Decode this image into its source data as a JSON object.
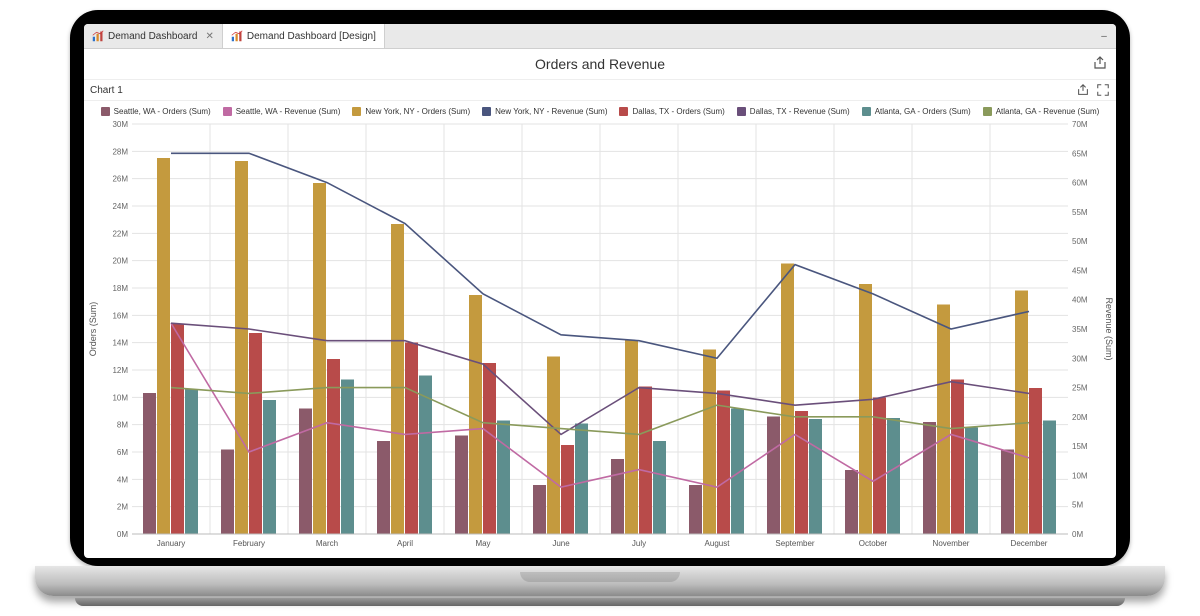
{
  "tabs": [
    {
      "label": "Demand Dashboard"
    },
    {
      "label": "Demand Dashboard [Design]"
    }
  ],
  "header": {
    "title": "Orders and Revenue"
  },
  "chart": {
    "title": "Chart 1"
  },
  "legend": [
    {
      "label": "Seattle, WA - Orders (Sum)",
      "color": "#8b5a6a",
      "kind": "bar"
    },
    {
      "label": "Seattle, WA - Revenue (Sum)",
      "color": "#c06aa3",
      "kind": "line"
    },
    {
      "label": "New York, NY - Orders (Sum)",
      "color": "#c49a3e",
      "kind": "bar"
    },
    {
      "label": "New York, NY - Revenue (Sum)",
      "color": "#4a567e",
      "kind": "line"
    },
    {
      "label": "Dallas, TX - Orders (Sum)",
      "color": "#b84b4a",
      "kind": "bar"
    },
    {
      "label": "Dallas, TX - Revenue (Sum)",
      "color": "#6a4f7a",
      "kind": "line"
    },
    {
      "label": "Atlanta, GA - Orders (Sum)",
      "color": "#5d8e8e",
      "kind": "bar"
    },
    {
      "label": "Atlanta, GA - Revenue (Sum)",
      "color": "#8a9a5b",
      "kind": "line"
    }
  ],
  "chart_data": {
    "type": "bar",
    "title": "Orders and Revenue",
    "xlabel": "",
    "ylabel_left": "Orders (Sum)",
    "ylabel_right": "Revenue (Sum)",
    "categories": [
      "January",
      "February",
      "March",
      "April",
      "May",
      "June",
      "July",
      "August",
      "September",
      "October",
      "November",
      "December"
    ],
    "ylim_left": [
      0,
      30000000
    ],
    "ylim_right": [
      0,
      70000000
    ],
    "ytick_step_left": 2000000,
    "ytick_step_right": 5000000,
    "bar_series": [
      {
        "name": "Seattle, WA - Orders (Sum)",
        "color": "#8b5a6a",
        "values": [
          10300000,
          6200000,
          9200000,
          6800000,
          7200000,
          3600000,
          5500000,
          3600000,
          8600000,
          4700000,
          8200000,
          6200000
        ]
      },
      {
        "name": "New York, NY - Orders (Sum)",
        "color": "#c49a3e",
        "values": [
          27500000,
          27300000,
          25700000,
          22700000,
          17500000,
          13000000,
          14200000,
          13500000,
          19800000,
          18300000,
          16800000,
          17800000
        ]
      },
      {
        "name": "Dallas, TX - Orders (Sum)",
        "color": "#b84b4a",
        "values": [
          15400000,
          14700000,
          12800000,
          14000000,
          12500000,
          6500000,
          10800000,
          10500000,
          9000000,
          10000000,
          11300000,
          10700000
        ]
      },
      {
        "name": "Atlanta, GA - Orders (Sum)",
        "color": "#5d8e8e",
        "values": [
          10600000,
          9800000,
          11300000,
          11600000,
          8300000,
          8100000,
          6800000,
          9200000,
          8400000,
          8500000,
          7800000,
          8300000
        ]
      }
    ],
    "line_series": [
      {
        "name": "Seattle, WA - Revenue (Sum)",
        "color": "#c06aa3",
        "values": [
          36000000,
          14000000,
          19000000,
          17000000,
          18000000,
          8000000,
          11000000,
          8000000,
          17000000,
          9000000,
          17000000,
          13000000
        ]
      },
      {
        "name": "New York, NY - Revenue (Sum)",
        "color": "#4a567e",
        "values": [
          65000000,
          65000000,
          60000000,
          53000000,
          41000000,
          34000000,
          33000000,
          30000000,
          46000000,
          41000000,
          35000000,
          38000000
        ]
      },
      {
        "name": "Dallas, TX - Revenue (Sum)",
        "color": "#6a4f7a",
        "values": [
          36000000,
          35000000,
          33000000,
          33000000,
          29000000,
          17000000,
          25000000,
          24000000,
          22000000,
          23000000,
          26000000,
          24000000
        ]
      },
      {
        "name": "Atlanta, GA - Revenue (Sum)",
        "color": "#8a9a5b",
        "values": [
          25000000,
          24000000,
          25000000,
          25000000,
          19000000,
          18000000,
          17000000,
          22000000,
          20000000,
          20000000,
          18000000,
          19000000
        ]
      }
    ]
  }
}
